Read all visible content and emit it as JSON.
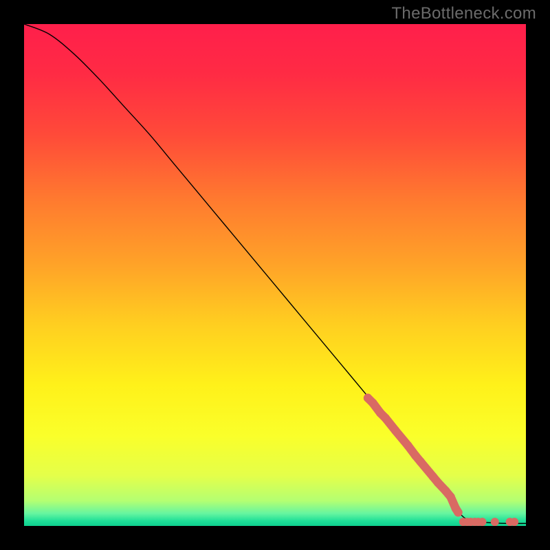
{
  "watermark": "TheBottleneck.com",
  "chart_data": {
    "type": "line",
    "title": "",
    "xlabel": "",
    "ylabel": "",
    "xlim": [
      0,
      100
    ],
    "ylim": [
      0,
      100
    ],
    "grid": false,
    "legend": false,
    "series": [
      {
        "name": "bottleneck-curve",
        "style": "line-thin-black",
        "points": [
          {
            "x": 0,
            "y": 100
          },
          {
            "x": 5,
            "y": 98
          },
          {
            "x": 10,
            "y": 94
          },
          {
            "x": 15,
            "y": 89
          },
          {
            "x": 20,
            "y": 83.5
          },
          {
            "x": 25,
            "y": 78
          },
          {
            "x": 30,
            "y": 72
          },
          {
            "x": 35,
            "y": 66
          },
          {
            "x": 40,
            "y": 60
          },
          {
            "x": 45,
            "y": 54
          },
          {
            "x": 50,
            "y": 48
          },
          {
            "x": 55,
            "y": 42
          },
          {
            "x": 60,
            "y": 36
          },
          {
            "x": 65,
            "y": 30
          },
          {
            "x": 70,
            "y": 24
          },
          {
            "x": 75,
            "y": 18
          },
          {
            "x": 80,
            "y": 12
          },
          {
            "x": 84,
            "y": 6
          },
          {
            "x": 87,
            "y": 2.3
          },
          {
            "x": 89,
            "y": 1.0
          },
          {
            "x": 92,
            "y": 0.7
          },
          {
            "x": 96,
            "y": 0.5
          },
          {
            "x": 100,
            "y": 0.5
          }
        ]
      },
      {
        "name": "highlight-segment",
        "style": "line-thick-salmon",
        "points": [
          {
            "x": 68.5,
            "y": 25.5
          },
          {
            "x": 69.5,
            "y": 24.5
          },
          {
            "x": 71,
            "y": 22.5
          },
          {
            "x": 72,
            "y": 21.5
          },
          {
            "x": 74,
            "y": 19.0
          },
          {
            "x": 76.5,
            "y": 16.0
          },
          {
            "x": 78,
            "y": 14.0
          },
          {
            "x": 79,
            "y": 12.8
          },
          {
            "x": 81.5,
            "y": 9.8
          },
          {
            "x": 82.5,
            "y": 8.6
          },
          {
            "x": 84,
            "y": 7.0
          },
          {
            "x": 85,
            "y": 5.8
          },
          {
            "x": 86,
            "y": 3.5
          },
          {
            "x": 86.5,
            "y": 2.7
          }
        ]
      },
      {
        "name": "floor-markers",
        "style": "points-salmon",
        "points": [
          {
            "x": 87.5,
            "y": 0.8
          },
          {
            "x": 88.3,
            "y": 0.8
          },
          {
            "x": 89.0,
            "y": 0.8
          },
          {
            "x": 89.8,
            "y": 0.8
          },
          {
            "x": 90.5,
            "y": 0.8
          },
          {
            "x": 91.3,
            "y": 0.8
          },
          {
            "x": 93.8,
            "y": 0.8
          },
          {
            "x": 96.8,
            "y": 0.8
          },
          {
            "x": 97.7,
            "y": 0.8
          }
        ]
      }
    ],
    "gradient_stops": [
      {
        "offset": 0.0,
        "color": "#ff1f4b"
      },
      {
        "offset": 0.1,
        "color": "#ff2b44"
      },
      {
        "offset": 0.22,
        "color": "#ff4a39"
      },
      {
        "offset": 0.35,
        "color": "#ff7a2f"
      },
      {
        "offset": 0.48,
        "color": "#ffa328"
      },
      {
        "offset": 0.6,
        "color": "#ffcf20"
      },
      {
        "offset": 0.72,
        "color": "#fff11a"
      },
      {
        "offset": 0.82,
        "color": "#faff2a"
      },
      {
        "offset": 0.9,
        "color": "#e4ff4a"
      },
      {
        "offset": 0.95,
        "color": "#b4ff72"
      },
      {
        "offset": 0.975,
        "color": "#66f5a0"
      },
      {
        "offset": 0.99,
        "color": "#1fdf98"
      },
      {
        "offset": 1.0,
        "color": "#0fd08f"
      }
    ],
    "colors": {
      "marker": "#d96a63",
      "curve": "#000000"
    }
  }
}
